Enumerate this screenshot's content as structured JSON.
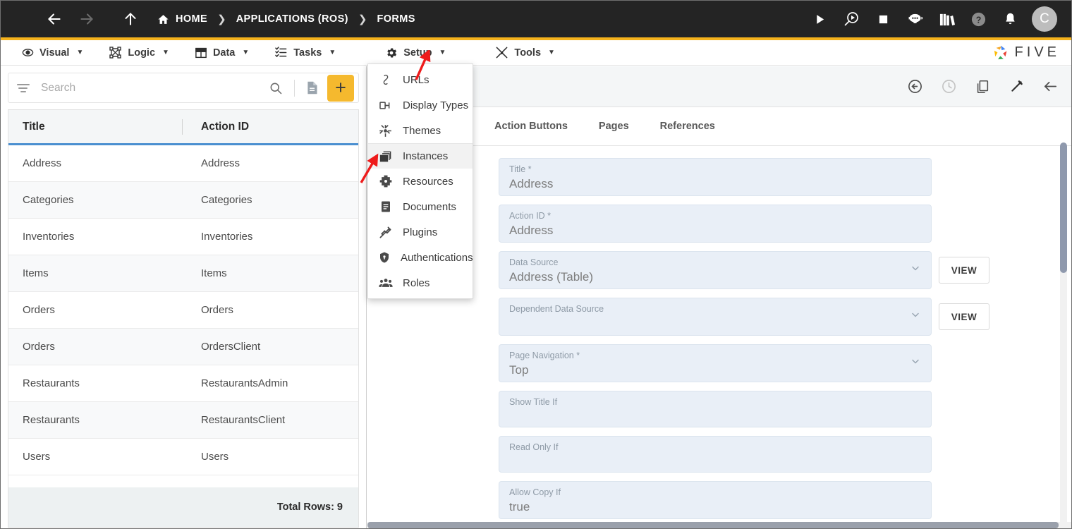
{
  "header": {
    "breadcrumbs": [
      {
        "label": "HOME",
        "icon": "home-icon"
      },
      {
        "label": "APPLICATIONS (ROS)",
        "icon": ""
      },
      {
        "label": "FORMS",
        "icon": ""
      }
    ],
    "separator": "❯",
    "nav_icons": [
      "menu-icon",
      "back-arrow-icon",
      "forward-arrow-icon",
      "up-arrow-icon"
    ],
    "action_icons": [
      "run-icon",
      "debug-icon",
      "stop-icon",
      "chatbot-icon",
      "library-icon",
      "help-icon",
      "notifications-icon"
    ],
    "avatar_initial": "C",
    "accent_color": "#f5b21c",
    "background_color": "#242424"
  },
  "menubar": {
    "items": [
      {
        "label": "Visual",
        "icon": "eye-icon",
        "caret": "▼"
      },
      {
        "label": "Logic",
        "icon": "logic-nodes-icon",
        "caret": "▼"
      },
      {
        "label": "Data",
        "icon": "table-grid-icon",
        "caret": "▼"
      },
      {
        "label": "Tasks",
        "icon": "checklist-icon",
        "caret": "▼"
      },
      {
        "label": "Setup",
        "icon": "gear-icon",
        "caret": "▼"
      },
      {
        "label": "Tools",
        "icon": "tools-icon",
        "caret": "▼"
      }
    ],
    "brand": "FIVE"
  },
  "setup_menu": {
    "items": [
      {
        "label": "URLs",
        "icon": "link-icon",
        "highlighted": false
      },
      {
        "label": "Display Types",
        "icon": "display-type-icon",
        "highlighted": false
      },
      {
        "label": "Themes",
        "icon": "theme-palette-icon",
        "highlighted": false
      },
      {
        "label": "Instances",
        "icon": "instances-stack-icon",
        "highlighted": true
      },
      {
        "label": "Resources",
        "icon": "resources-puzzle-icon",
        "highlighted": false
      },
      {
        "label": "Documents",
        "icon": "document-icon",
        "highlighted": false
      },
      {
        "label": "Plugins",
        "icon": "plug-icon",
        "highlighted": false
      },
      {
        "label": "Authentications",
        "icon": "shield-icon",
        "highlighted": false
      },
      {
        "label": "Roles",
        "icon": "users-group-icon",
        "highlighted": false
      }
    ]
  },
  "left_panel": {
    "search": {
      "placeholder": "Search",
      "value": ""
    },
    "toolbar_icons": [
      "filter-icon",
      "search-icon",
      "document-icon",
      "add-icon"
    ],
    "add_button_label": "+",
    "grid": {
      "columns": [
        "Title",
        "Action ID"
      ],
      "rows": [
        {
          "title": "Address",
          "action_id": "Address"
        },
        {
          "title": "Categories",
          "action_id": "Categories"
        },
        {
          "title": "Inventories",
          "action_id": "Inventories"
        },
        {
          "title": "Items",
          "action_id": "Items"
        },
        {
          "title": "Orders",
          "action_id": "Orders"
        },
        {
          "title": "Orders",
          "action_id": "OrdersClient"
        },
        {
          "title": "Restaurants",
          "action_id": "RestaurantsAdmin"
        },
        {
          "title": "Restaurants",
          "action_id": "RestaurantsClient"
        },
        {
          "title": "Users",
          "action_id": "Users"
        }
      ],
      "footer": "Total Rows: 9"
    }
  },
  "right_panel": {
    "toolbar_icons": [
      "revert-icon",
      "history-icon",
      "copy-icon",
      "edit-icon",
      "back-icon"
    ],
    "tabs": [
      {
        "label": "Action Buttons",
        "active": false
      },
      {
        "label": "Pages",
        "active": false
      },
      {
        "label": "References",
        "active": false
      }
    ],
    "fields": [
      {
        "label": "Title *",
        "value": "Address",
        "type": "text",
        "has_view": false
      },
      {
        "label": "Action ID *",
        "value": "Address",
        "type": "text",
        "has_view": false
      },
      {
        "label": "Data Source",
        "value": "Address (Table)",
        "type": "select",
        "has_view": true,
        "view_label": "VIEW"
      },
      {
        "label": "Dependent Data Source",
        "value": "",
        "type": "select",
        "has_view": true,
        "view_label": "VIEW"
      },
      {
        "label": "Page Navigation *",
        "value": "Top",
        "type": "select",
        "has_view": false
      },
      {
        "label": "Show Title If",
        "value": "",
        "type": "text",
        "has_view": false
      },
      {
        "label": "Read Only If",
        "value": "",
        "type": "text",
        "has_view": false
      },
      {
        "label": "Allow Copy If",
        "value": "true",
        "type": "text",
        "has_view": false
      }
    ]
  }
}
